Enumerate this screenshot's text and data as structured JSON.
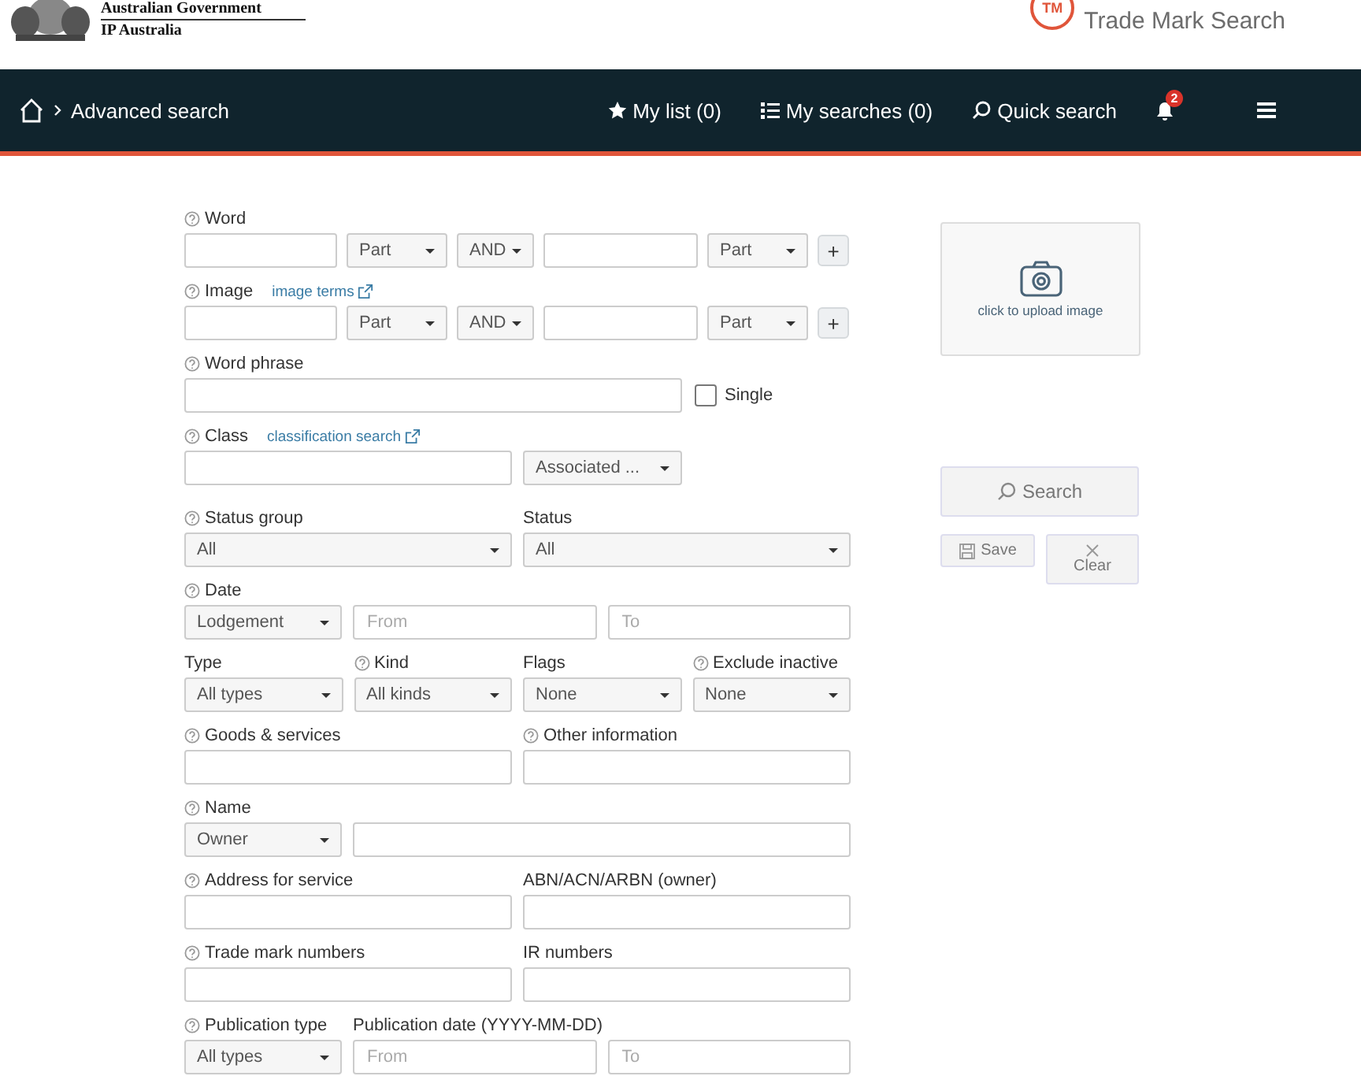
{
  "header": {
    "agency": "Australian Government",
    "org": "IP Australia",
    "badge": "TM",
    "app_title": "Trade Mark Search"
  },
  "nav": {
    "breadcrumb": "Advanced search",
    "items": [
      {
        "label": "My list (0)"
      },
      {
        "label": "My searches (0)"
      },
      {
        "label": "Quick search"
      }
    ],
    "notifications": "2"
  },
  "form": [
    {
      "kind": "terms",
      "labels": [
        {
          "text": "Word",
          "help": true
        }
      ],
      "controls": [
        {
          "kind": "input"
        },
        {
          "kind": "select",
          "value": "Part"
        },
        {
          "kind": "select",
          "value": "AND"
        },
        {
          "kind": "input"
        },
        {
          "kind": "select",
          "value": "Part"
        },
        {
          "kind": "add",
          "text": "+"
        }
      ]
    },
    {
      "kind": "terms",
      "labels": [
        {
          "text": "Image",
          "help": true,
          "link": "image terms"
        }
      ],
      "controls": [
        {
          "kind": "input"
        },
        {
          "kind": "select",
          "value": "Part"
        },
        {
          "kind": "select",
          "value": "AND"
        },
        {
          "kind": "input"
        },
        {
          "kind": "select",
          "value": "Part"
        },
        {
          "kind": "add",
          "text": "+"
        }
      ]
    },
    {
      "kind": "phrase",
      "labels": [
        {
          "text": "Word phrase",
          "help": true
        }
      ],
      "controls": [
        {
          "kind": "input"
        },
        {
          "kind": "checkbox",
          "text": "Single",
          "checked": false
        }
      ]
    },
    {
      "kind": "class",
      "labels": [
        {
          "text": "Class",
          "help": true,
          "link": "classification search"
        }
      ],
      "controls": [
        {
          "kind": "input"
        },
        {
          "kind": "select",
          "value": "Associated ..."
        }
      ]
    },
    {
      "kind": "pair",
      "labels": [
        {
          "text": "Status group",
          "help": true
        },
        {
          "text": "Status",
          "help": false
        }
      ],
      "controls": [
        {
          "kind": "select",
          "value": "All"
        },
        {
          "kind": "select",
          "value": "All"
        }
      ]
    },
    {
      "kind": "date",
      "labels": [
        {
          "text": "Date",
          "help": true
        }
      ],
      "controls": [
        {
          "kind": "select",
          "value": "Lodgement"
        },
        {
          "kind": "input",
          "placeholder": "From"
        },
        {
          "kind": "input",
          "placeholder": "To"
        }
      ]
    },
    {
      "kind": "quad",
      "labels": [
        {
          "text": "Type",
          "help": false
        },
        {
          "text": "Kind",
          "help": true
        },
        {
          "text": "Flags",
          "help": false
        },
        {
          "text": "Exclude inactive",
          "help": true
        }
      ],
      "controls": [
        {
          "kind": "select",
          "value": "All types"
        },
        {
          "kind": "select",
          "value": "All kinds"
        },
        {
          "kind": "select",
          "value": "None"
        },
        {
          "kind": "select",
          "value": "None"
        }
      ]
    },
    {
      "kind": "pair",
      "labels": [
        {
          "text": "Goods & services",
          "help": true
        },
        {
          "text": "Other information",
          "help": true
        }
      ],
      "controls": [
        {
          "kind": "input"
        },
        {
          "kind": "input"
        }
      ]
    },
    {
      "kind": "name",
      "labels": [
        {
          "text": "Name",
          "help": true
        }
      ],
      "controls": [
        {
          "kind": "select",
          "value": "Owner"
        },
        {
          "kind": "input"
        }
      ]
    },
    {
      "kind": "pair",
      "labels": [
        {
          "text": "Address for service",
          "help": true
        },
        {
          "text": "ABN/ACN/ARBN (owner)",
          "help": false
        }
      ],
      "controls": [
        {
          "kind": "input"
        },
        {
          "kind": "input"
        }
      ]
    },
    {
      "kind": "pair",
      "labels": [
        {
          "text": "Trade mark numbers",
          "help": true
        },
        {
          "text": "IR numbers",
          "help": false
        }
      ],
      "controls": [
        {
          "kind": "input"
        },
        {
          "kind": "input"
        }
      ]
    },
    {
      "kind": "pub",
      "labels": [
        {
          "text": "Publication type",
          "help": true
        },
        {
          "text": "Publication date (YYYY-MM-DD)",
          "help": false
        }
      ],
      "controls": [
        {
          "kind": "select",
          "value": "All types"
        },
        {
          "kind": "input",
          "placeholder": "From"
        },
        {
          "kind": "input",
          "placeholder": "To"
        }
      ]
    }
  ],
  "side": {
    "upload": "click to upload image",
    "search": "Search",
    "save": "Save",
    "clear": "Clear"
  }
}
